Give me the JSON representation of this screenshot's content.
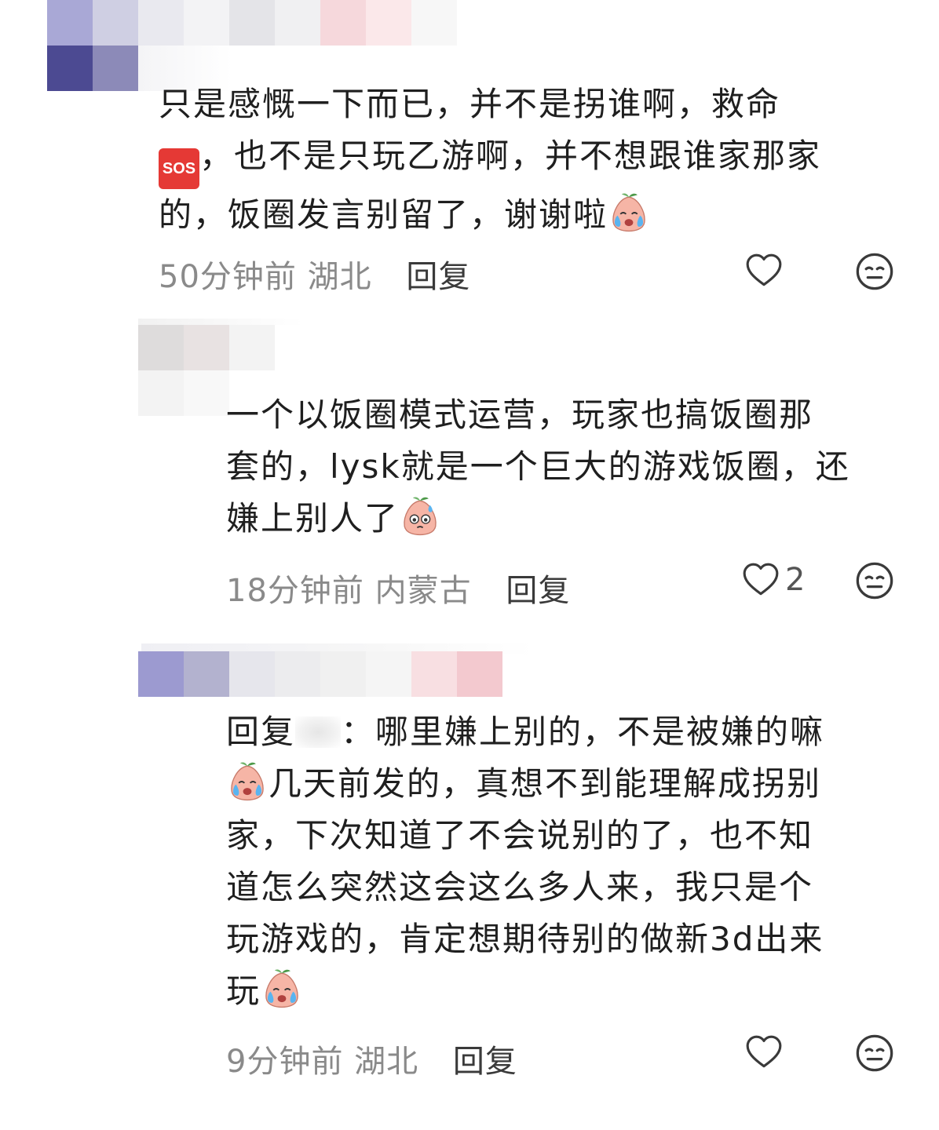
{
  "comments": [
    {
      "text_line1": "只是感慨一下而已，并不是拐谁啊，救命",
      "text_line2_pre": "，也不是只玩乙游啊，并不想跟谁家那家",
      "text_line3": "的，饭圈发言别留了，谢谢啦",
      "sos_label": "SOS",
      "emoji_icon": "crying-peach-emoji",
      "time": "50分钟前",
      "location": "湖北",
      "reply": "回复",
      "likes": ""
    },
    {
      "text_line1": "一个以饭圈模式运营，玩家也搞饭圈那",
      "text_line2": "套的，lysk就是一个巨大的游戏饭圈，还",
      "text_line3": "嫌上别人了",
      "emoji_icon": "sweating-peach-emoji",
      "time": "18分钟前",
      "location": "内蒙古",
      "reply": "回复",
      "likes": "2"
    },
    {
      "reply_prefix": "回复",
      "text_line1_rest": "：哪里嫌上别的，不是被嫌的嘛",
      "text_line2": "几天前发的，真想不到能理解成拐别",
      "text_line3": "家，下次知道了不会说别的了，也不知",
      "text_line4": "道怎么突然这会这么多人来，我只是个",
      "text_line5": "玩游戏的，肯定想期待别的做新3d出来",
      "text_line6": "玩",
      "emoji_icon": "crying-peach-emoji",
      "time": "9分钟前",
      "location": "湖北",
      "reply": "回复",
      "likes": ""
    }
  ],
  "colors": {
    "text": "#1f1f1f",
    "meta": "#8a8a8a",
    "icon": "#3a3a3a"
  }
}
